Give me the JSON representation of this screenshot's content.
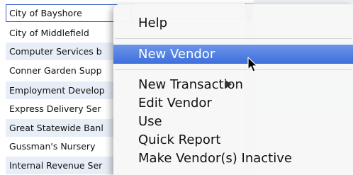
{
  "vendors": [
    "City of Bayshore",
    "City of Middlefield",
    "Computer Services b",
    "Conner Garden Supp",
    "Employment Develop",
    "Express Delivery Ser",
    "Great Statewide Banl",
    "Gussman's Nursery",
    "Internal Revenue Ser"
  ],
  "menu": {
    "help": "Help",
    "new_vendor": "New Vendor",
    "new_transaction": "New Transaction",
    "edit_vendor": "Edit Vendor",
    "use": "Use",
    "quick_report": "Quick Report",
    "make_inactive": "Make Vendor(s) Inactive"
  },
  "icons": {
    "submenu": "submenu-arrow-icon",
    "cursor": "mouse-pointer-icon"
  },
  "colors": {
    "highlight": "#3d6fdc",
    "selection_border": "#3b63c4",
    "row_alt": "#e8eef7"
  }
}
